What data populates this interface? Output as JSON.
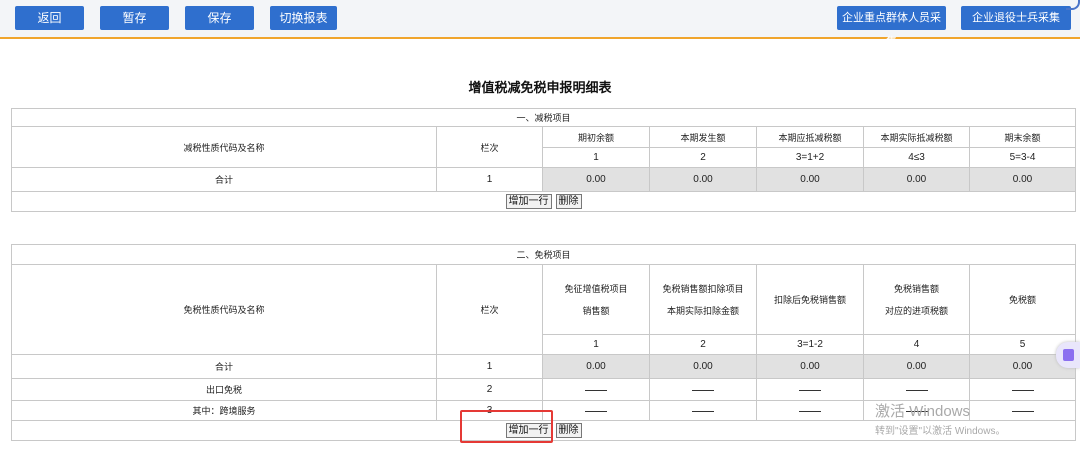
{
  "toolbar": {
    "back": "返回",
    "save_draft": "暂存",
    "save": "保存",
    "switch_report": "切换报表",
    "key_group_collect": "企业重点群体人员采集",
    "veteran_collect": "企业退役士兵采集"
  },
  "page_title": "增值税减免税申报明细表",
  "reduction": {
    "section_title": "一、减税项目",
    "col_name": "减税性质代码及名称",
    "col_seq": "栏次",
    "columns": [
      "期初余额",
      "本期发生额",
      "本期应抵减税额",
      "本期实际抵减税额",
      "期末余额"
    ],
    "col_numbers": [
      "1",
      "2",
      "3=1+2",
      "4≤3",
      "5=3-4"
    ],
    "total_label": "合计",
    "total_seq": "1",
    "total_values": [
      "0.00",
      "0.00",
      "0.00",
      "0.00",
      "0.00"
    ],
    "add_row": "增加一行",
    "delete": "删除"
  },
  "exemption": {
    "section_title": "二、免税项目",
    "col_name": "免税性质代码及名称",
    "col_seq": "栏次",
    "col1_line1": "免征增值税项目",
    "col1_line2": "销售额",
    "col2_line1": "免税销售额扣除项目",
    "col2_line2": "本期实际扣除金额",
    "col3": "扣除后免税销售额",
    "col4_line1": "免税销售额",
    "col4_line2": "对应的进项税额",
    "col5": "免税额",
    "col_numbers": [
      "1",
      "2",
      "3=1-2",
      "4",
      "5"
    ],
    "total_label": "合计",
    "total_seq": "1",
    "total_values": [
      "0.00",
      "0.00",
      "0.00",
      "0.00",
      "0.00"
    ],
    "export_label": "出口免税",
    "export_seq": "2",
    "crossborder_label": "其中：跨境服务",
    "crossborder_seq": "3",
    "add_row": "增加一行",
    "delete": "删除"
  },
  "watermark": {
    "line1": "激活 Windows",
    "line2": "转到\"设置\"以激活 Windows。"
  },
  "colors": {
    "primary_button": "#2f6fce",
    "toolbar_border": "#f0a52d",
    "highlight_box": "#e53935",
    "readonly_cell": "#e1e1e1"
  }
}
